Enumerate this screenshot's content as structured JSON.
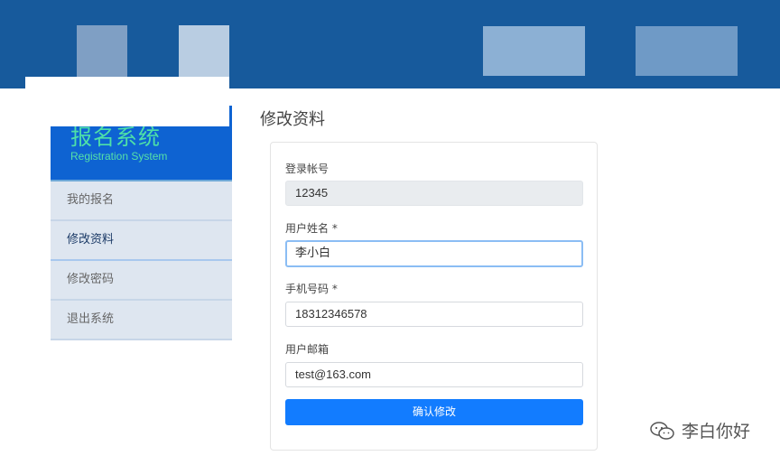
{
  "sidebar": {
    "brand_cn": "报名系统",
    "brand_en": "Registration System",
    "items": [
      {
        "label": "我的报名"
      },
      {
        "label": "修改资料"
      },
      {
        "label": "修改密码"
      },
      {
        "label": "退出系统"
      }
    ]
  },
  "main": {
    "title": "修改资料",
    "form": {
      "account_label": "登录帐号",
      "account_value": "12345",
      "name_label": "用户姓名 *",
      "name_value": "李小白",
      "phone_label": "手机号码 *",
      "phone_value": "18312346578",
      "email_label": "用户邮箱",
      "email_value": "test@163.com",
      "submit_label": "确认修改"
    }
  },
  "watermark": {
    "text": "李白你好",
    "icon": "wechat-icon"
  },
  "colors": {
    "header": "#175a9c",
    "brand_bg": "#0e63d2",
    "brand_text": "#4ee0a8",
    "button": "#127cff"
  }
}
